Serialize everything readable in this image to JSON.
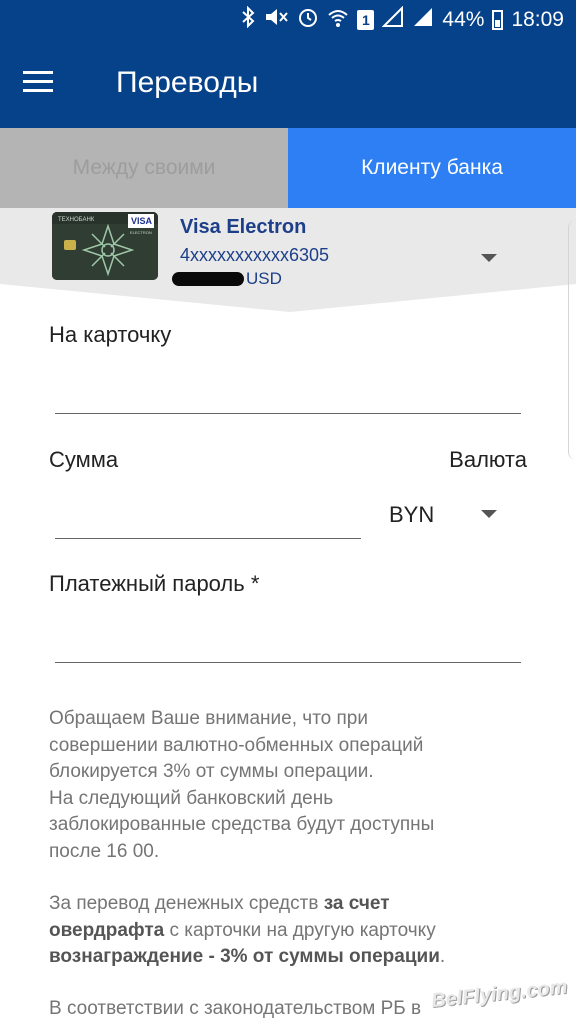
{
  "status_bar": {
    "battery": "44%",
    "time": "18:09",
    "sim": "1"
  },
  "header": {
    "title": "Переводы"
  },
  "tabs": [
    {
      "label": "Между своими",
      "active": false
    },
    {
      "label": "Клиенту банка",
      "active": true
    }
  ],
  "card": {
    "bank_name": "ТЕХНОБАНК",
    "brand": "VISA",
    "brand_sub": "ELECTRON",
    "name": "Visa Electron",
    "number": "4xxxxxxxxxxx6305",
    "currency": "USD"
  },
  "form": {
    "to_card_label": "На карточку",
    "amount_label": "Сумма",
    "currency_label": "Валюта",
    "currency_value": "BYN",
    "password_label": "Платежный пароль *"
  },
  "notice": {
    "p1_lines": [
      "Обращаем Ваше внимание, что при",
      "совершении валютно-обменных операций",
      "блокируется 3% от суммы операции.",
      "На следующий банковский день",
      "заблокированные средства будут доступны",
      "после 16 00."
    ],
    "p2_line1_a": "За перевод денежных средств ",
    "p2_line1_b": "за счет",
    "p2_line2_a": "овердрафта",
    "p2_line2_b": " с карточки на другую карточку",
    "p2_line3_a": "вознаграждение - 3% от суммы операции",
    "p2_line3_b": ".",
    "p3_line1": "В соответствии с законодательством РБ в"
  },
  "watermark": "BelFlying.com",
  "colors": {
    "primary": "#06428a",
    "tab_active": "#2d7ff3",
    "tab_inactive": "#b4b4b4",
    "card_text": "#1d3f8a"
  },
  "icons": [
    "bluetooth-icon",
    "mute-icon",
    "alarm-icon",
    "wifi-icon",
    "signal-icon",
    "battery-icon",
    "menu-icon",
    "dropdown-arrow-icon"
  ]
}
